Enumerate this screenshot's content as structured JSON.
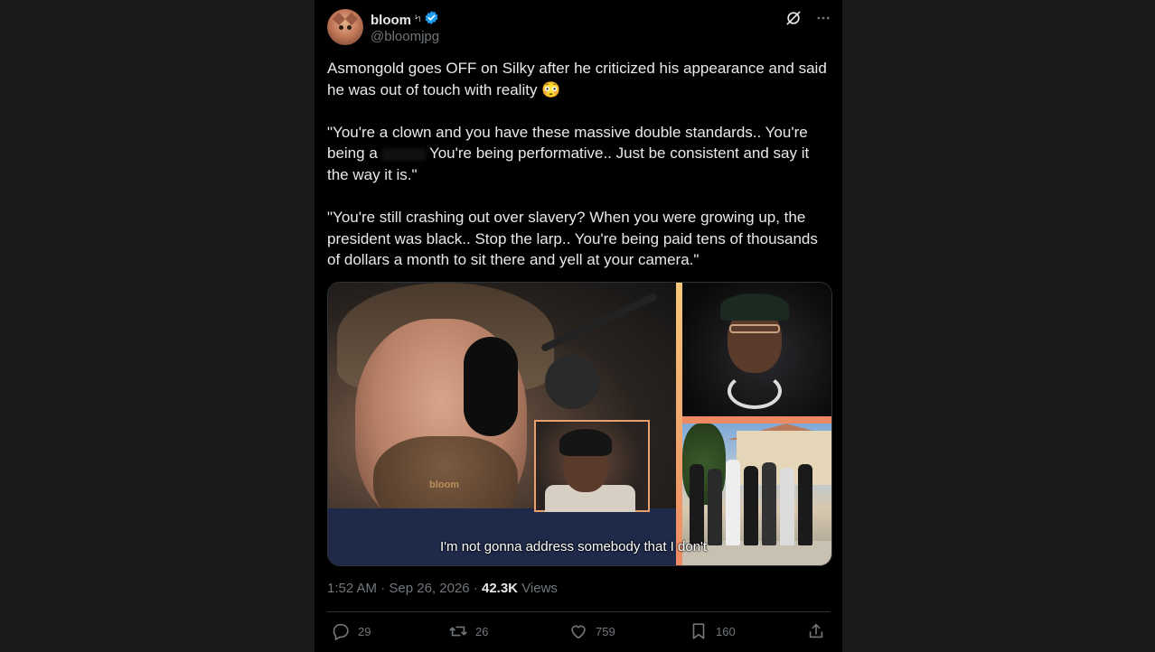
{
  "author": {
    "display_name": "bloom",
    "emoji": "৸",
    "handle": "@bloomjpg"
  },
  "tweet": {
    "paragraphs": [
      "Asmongold goes OFF on Silky after he criticized his appearance and said he was out of touch with reality 😳",
      "\"You're a clown and you have these massive double standards.. You're being a",
      "You're being performative.. Just be consistent and say it the way it is.\"",
      "\"You're still crashing out over slavery? When you were growing up, the president was black.. Stop the larp.. You're being paid tens of thousands of dollars a month to sit there and yell at your camera.\""
    ]
  },
  "media": {
    "caption": "I'm not gonna address somebody that I don't",
    "watermark": "bloom"
  },
  "meta": {
    "time": "1:52 AM",
    "date": "Sep 26, 2026",
    "views_count": "42.3K",
    "views_label": "Views"
  },
  "actions": {
    "replies": "29",
    "reposts": "26",
    "likes": "759",
    "bookmarks": "160"
  },
  "colors": {
    "background": "#000000",
    "text": "#e7e9ea",
    "muted": "#71767b",
    "verified": "#1d9bf0"
  },
  "icons": [
    "verified-badge-icon",
    "grok-icon",
    "more-icon",
    "reply-icon",
    "repost-icon",
    "like-icon",
    "bookmark-icon",
    "share-icon"
  ]
}
